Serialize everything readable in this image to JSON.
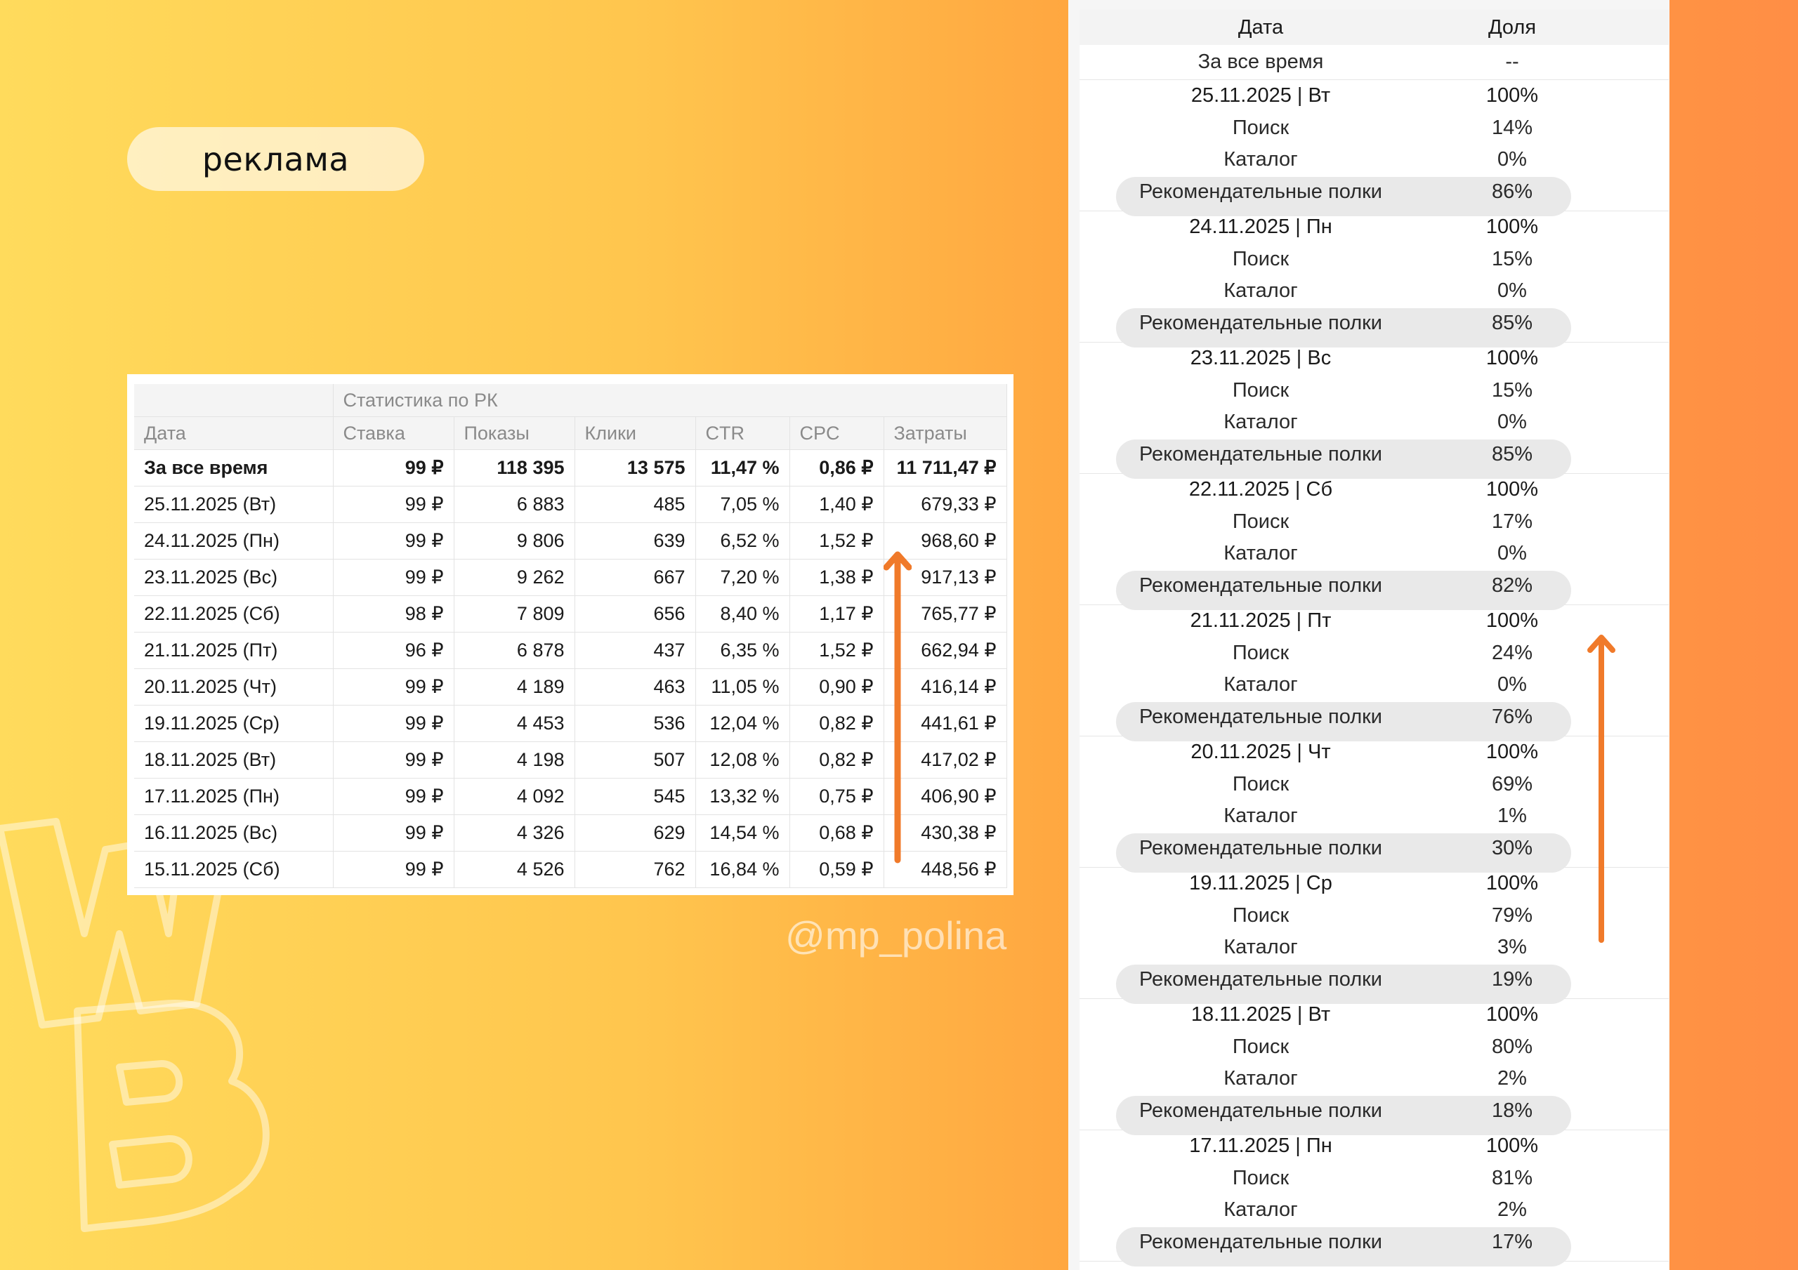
{
  "tag": "реклама",
  "watermark": "@mp_polina",
  "stats": {
    "group_header": "Статистика по РК",
    "columns": [
      "Дата",
      "Ставка",
      "Показы",
      "Клики",
      "CTR",
      "CPC",
      "Затраты"
    ],
    "rows": [
      {
        "date": "За все время",
        "rate": "99 ₽",
        "views": "118 395",
        "clicks": "13 575",
        "ctr": "11,47 %",
        "cpc": "0,86 ₽",
        "cost": "11 711,47 ₽"
      },
      {
        "date": "25.11.2025 (Вт)",
        "rate": "99 ₽",
        "views": "6 883",
        "clicks": "485",
        "ctr": "7,05 %",
        "cpc": "1,40 ₽",
        "cost": "679,33 ₽"
      },
      {
        "date": "24.11.2025 (Пн)",
        "rate": "99 ₽",
        "views": "9 806",
        "clicks": "639",
        "ctr": "6,52 %",
        "cpc": "1,52 ₽",
        "cost": "968,60 ₽"
      },
      {
        "date": "23.11.2025 (Вс)",
        "rate": "99 ₽",
        "views": "9 262",
        "clicks": "667",
        "ctr": "7,20 %",
        "cpc": "1,38 ₽",
        "cost": "917,13 ₽"
      },
      {
        "date": "22.11.2025 (Сб)",
        "rate": "98 ₽",
        "views": "7 809",
        "clicks": "656",
        "ctr": "8,40 %",
        "cpc": "1,17 ₽",
        "cost": "765,77 ₽"
      },
      {
        "date": "21.11.2025 (Пт)",
        "rate": "96 ₽",
        "views": "6 878",
        "clicks": "437",
        "ctr": "6,35 %",
        "cpc": "1,52 ₽",
        "cost": "662,94 ₽"
      },
      {
        "date": "20.11.2025 (Чт)",
        "rate": "99 ₽",
        "views": "4 189",
        "clicks": "463",
        "ctr": "11,05 %",
        "cpc": "0,90 ₽",
        "cost": "416,14 ₽"
      },
      {
        "date": "19.11.2025 (Ср)",
        "rate": "99 ₽",
        "views": "4 453",
        "clicks": "536",
        "ctr": "12,04 %",
        "cpc": "0,82 ₽",
        "cost": "441,61 ₽"
      },
      {
        "date": "18.11.2025 (Вт)",
        "rate": "99 ₽",
        "views": "4 198",
        "clicks": "507",
        "ctr": "12,08 %",
        "cpc": "0,82 ₽",
        "cost": "417,02 ₽"
      },
      {
        "date": "17.11.2025 (Пн)",
        "rate": "99 ₽",
        "views": "4 092",
        "clicks": "545",
        "ctr": "13,32 %",
        "cpc": "0,75 ₽",
        "cost": "406,90 ₽"
      },
      {
        "date": "16.11.2025 (Вс)",
        "rate": "99 ₽",
        "views": "4 326",
        "clicks": "629",
        "ctr": "14,54 %",
        "cpc": "0,68 ₽",
        "cost": "430,38 ₽"
      },
      {
        "date": "15.11.2025 (Сб)",
        "rate": "99 ₽",
        "views": "4 526",
        "clicks": "762",
        "ctr": "16,84 %",
        "cpc": "0,59 ₽",
        "cost": "448,56 ₽"
      }
    ]
  },
  "share": {
    "col_date": "Дата",
    "col_share": "Доля",
    "total_label": "За все время",
    "total_value": "--",
    "labels": {
      "search": "Поиск",
      "catalog": "Каталог",
      "rec": "Рекомендательные полки"
    },
    "groups": [
      {
        "date": "25.11.2025 | Вт",
        "total": "100%",
        "search": "14%",
        "catalog": "0%",
        "rec": "86%"
      },
      {
        "date": "24.11.2025 | Пн",
        "total": "100%",
        "search": "15%",
        "catalog": "0%",
        "rec": "85%"
      },
      {
        "date": "23.11.2025 | Вс",
        "total": "100%",
        "search": "15%",
        "catalog": "0%",
        "rec": "85%"
      },
      {
        "date": "22.11.2025 | Сб",
        "total": "100%",
        "search": "17%",
        "catalog": "0%",
        "rec": "82%"
      },
      {
        "date": "21.11.2025 | Пт",
        "total": "100%",
        "search": "24%",
        "catalog": "0%",
        "rec": "76%"
      },
      {
        "date": "20.11.2025 | Чт",
        "total": "100%",
        "search": "69%",
        "catalog": "1%",
        "rec": "30%"
      },
      {
        "date": "19.11.2025 | Ср",
        "total": "100%",
        "search": "79%",
        "catalog": "3%",
        "rec": "19%"
      },
      {
        "date": "18.11.2025 | Вт",
        "total": "100%",
        "search": "80%",
        "catalog": "2%",
        "rec": "18%"
      },
      {
        "date": "17.11.2025 | Пн",
        "total": "100%",
        "search": "81%",
        "catalog": "2%",
        "rec": "17%"
      }
    ]
  },
  "colors": {
    "arrow": "#f07a2a",
    "pill": "#e9e9e9"
  }
}
